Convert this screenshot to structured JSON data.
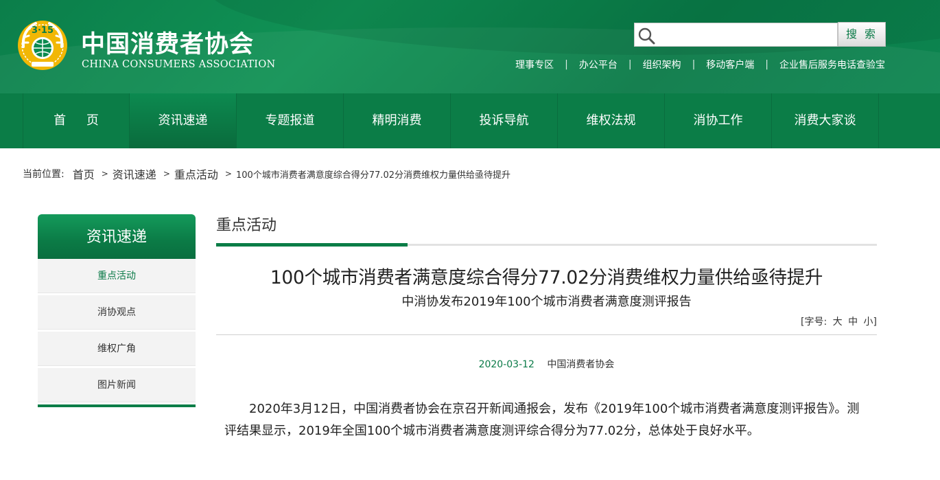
{
  "header": {
    "logo_cn": "中国消费者协会",
    "logo_en": "CHINA CONSUMERS ASSOCIATION",
    "search_placeholder": "",
    "search_button": "搜 索",
    "top_links": [
      "理事专区",
      "办公平台",
      "组织架构",
      "移动客户端",
      "企业售后服务电话查验宝"
    ],
    "separator": "|"
  },
  "nav": {
    "items": [
      "首 页",
      "资讯速递",
      "专题报道",
      "精明消费",
      "投诉导航",
      "维权法规",
      "消协工作",
      "消费大家谈"
    ]
  },
  "breadcrumb": {
    "label": "当前位置:",
    "items": [
      "首页",
      "资讯速递",
      "重点活动"
    ],
    "current": "100个城市消费者满意度综合得分77.02分消费维权力量供给亟待提升",
    "arrow": ">"
  },
  "sidebar": {
    "title": "资讯速递",
    "items": [
      "重点活动",
      "消协观点",
      "维权广角",
      "图片新闻"
    ]
  },
  "main": {
    "section_title": "重点活动",
    "article_title": "100个城市消费者满意度综合得分77.02分消费维权力量供给亟待提升",
    "article_subtitle": "中消协发布2019年100个城市消费者满意度测评报告",
    "font_ctrl": {
      "open": "[字号:",
      "large": "大",
      "medium": "中",
      "small": "小",
      "close": "]"
    },
    "date": "2020-03-12",
    "source": "中国消费者协会",
    "body": "2020年3月12日，中国消费者协会在京召开新闻通报会，发布《2019年100个城市消费者满意度测评报告》。测评结果显示，2019年全国100个城市消费者满意度测评综合得分为77.02分，总体处于良好水平。"
  },
  "colors": {
    "brand_green": "#0b7d47",
    "header_green": "#109255",
    "emblem_gold": "#f2b705",
    "accent_text_green": "#0a7a47"
  },
  "icons": {
    "logo": "cca-315-emblem-icon",
    "search": "search-icon"
  }
}
